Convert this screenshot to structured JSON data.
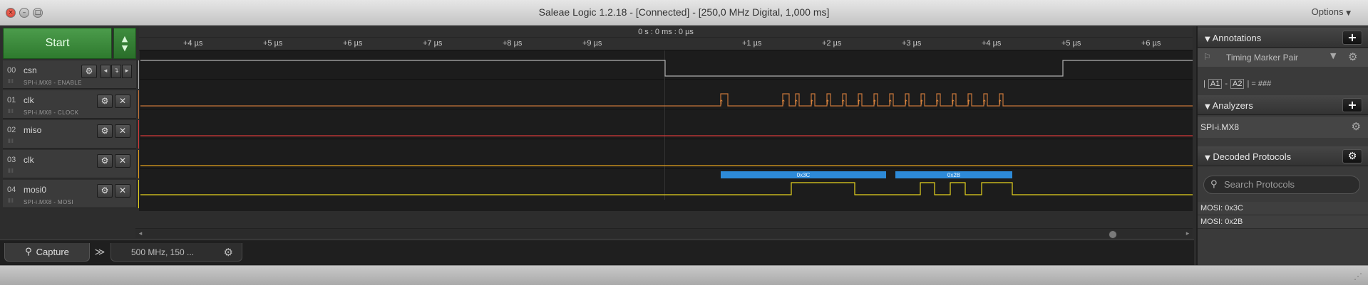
{
  "window": {
    "title": "Saleae Logic 1.2.18 - [Connected] - [250,0 MHz Digital, 1,000 ms]",
    "options_label": "Options",
    "close_glyph": "×",
    "minimize_glyph": "–",
    "maximize_glyph": "□"
  },
  "capture_control": {
    "start_label": "Start",
    "up_arrow": "▲",
    "down_arrow": "▼"
  },
  "channels": [
    {
      "number": "00",
      "name": "csn",
      "analyzer_tag": "SPI-i.MX8 - ENABLE",
      "color": "#b0b0b0"
    },
    {
      "number": "01",
      "name": "clk",
      "analyzer_tag": "SPI-i.MX8 - CLOCK",
      "color": "#c7763a"
    },
    {
      "number": "02",
      "name": "miso",
      "analyzer_tag": "",
      "color": "#d63a3a"
    },
    {
      "number": "03",
      "name": "clk",
      "analyzer_tag": "",
      "color": "#e4a11d"
    },
    {
      "number": "04",
      "name": "mosi0",
      "analyzer_tag": "SPI-i.MX8 - MOSI",
      "color": "#e5d21e"
    }
  ],
  "channel_buttons": {
    "gear": "⚙",
    "close": "✕",
    "prev": "◂",
    "edge": "↴",
    "next": "▸"
  },
  "timeline": {
    "center_label": "0 s : 0 ms : 0 µs",
    "ticks": [
      "+4 µs",
      "+5 µs",
      "+6 µs",
      "+7 µs",
      "+8 µs",
      "+9 µs",
      "+1 µs",
      "+2 µs",
      "+3 µs",
      "+4 µs",
      "+5 µs",
      "+6 µs"
    ]
  },
  "decoded_bubbles": [
    {
      "label": "0x3C"
    },
    {
      "label": "0x2B"
    }
  ],
  "bottom_tabs": {
    "capture_label": "Capture",
    "more_glyph": "≫",
    "session_setting": "500 MHz, 150 ...",
    "gear": "⚙",
    "capture_icon": "⚲"
  },
  "scrollbar": {
    "left": "◂",
    "right": "▸"
  },
  "right_panel": {
    "annotations": {
      "header": "Annotations",
      "add": "+",
      "marker_type": "Timing Marker Pair",
      "dropdown_glyph": "▼",
      "pin_glyph": "⚐",
      "formula_open": "|",
      "a1": "A1",
      "minus": "-",
      "a2": "A2",
      "formula_close": "| = ###"
    },
    "analyzers": {
      "header": "Analyzers",
      "add": "+",
      "items": [
        "SPI-i.MX8"
      ]
    },
    "decoded_protocols": {
      "header": "Decoded Protocols",
      "search_placeholder": "Search Protocols",
      "search_icon": "⚲",
      "items": [
        "MOSI: 0x3C",
        "MOSI: 0x2B"
      ]
    },
    "collapse_glyph": "▼"
  },
  "statusbar": {
    "resize_glyph": "⋰"
  }
}
